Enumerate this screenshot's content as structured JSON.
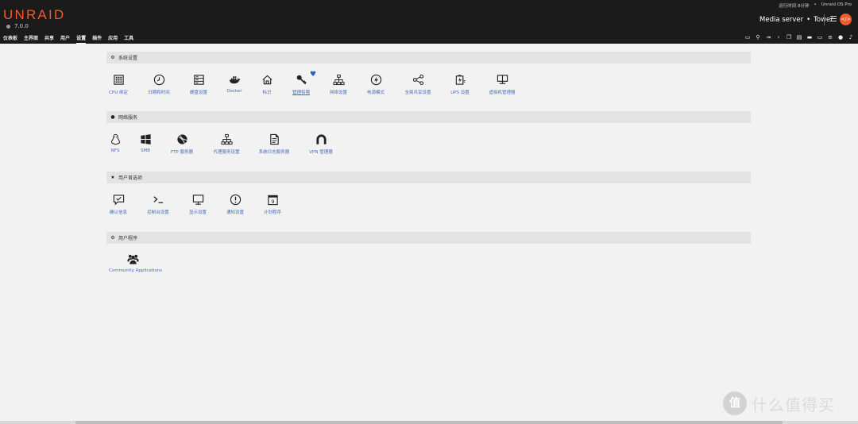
{
  "header": {
    "logo": "UNRAID",
    "version": "7.0.0",
    "uptime": "运行时间 8分钟",
    "edition": "Unraid OS Pro",
    "server_name": "Media server",
    "server_host": "Tower",
    "accent_color": "#f15a2c"
  },
  "nav": {
    "items": [
      {
        "label": "仪表板"
      },
      {
        "label": "主界面"
      },
      {
        "label": "共享"
      },
      {
        "label": "用户"
      },
      {
        "label": "设置"
      },
      {
        "label": "插件"
      },
      {
        "label": "应用"
      },
      {
        "label": "工具"
      }
    ],
    "active": "设置",
    "right_icons": [
      "feedback-icon",
      "search-icon",
      "logout-icon",
      "terminal-icon",
      "copy-icon",
      "log-icon",
      "display-icon",
      "monitor-icon",
      "notes-icon",
      "info-icon",
      "bell-icon"
    ]
  },
  "sections": [
    {
      "title": "系统设置",
      "icon": "gear-icon",
      "items": [
        {
          "label": "CPU 绑定",
          "icon": "cpu-icon"
        },
        {
          "label": "日期和时间",
          "icon": "clock-icon"
        },
        {
          "label": "硬盘设置",
          "icon": "disk-icon"
        },
        {
          "label": "Docker",
          "icon": "docker-icon"
        },
        {
          "label": "标识",
          "icon": "home-icon"
        },
        {
          "label": "管理权限",
          "icon": "key-icon"
        },
        {
          "label": "网络设置",
          "icon": "network-icon"
        },
        {
          "label": "电源模式",
          "icon": "power-icon"
        },
        {
          "label": "全局共享设置",
          "icon": "share-icon"
        },
        {
          "label": "UPS 设置",
          "icon": "battery-icon"
        },
        {
          "label": "虚拟机管理器",
          "icon": "vm-icon"
        }
      ]
    },
    {
      "title": "网络服务",
      "icon": "globe-icon",
      "items": [
        {
          "label": "NFS",
          "icon": "linux-icon"
        },
        {
          "label": "SMB",
          "icon": "windows-icon"
        },
        {
          "label": "FTP 服务器",
          "icon": "ftp-icon"
        },
        {
          "label": "代理服务设置",
          "icon": "proxy-icon"
        },
        {
          "label": "系统日志服务器",
          "icon": "syslog-icon"
        },
        {
          "label": "VPN 管理器",
          "icon": "vpn-icon"
        }
      ]
    },
    {
      "title": "用户首选项",
      "icon": "star-icon",
      "items": [
        {
          "label": "确认信息",
          "icon": "confirm-icon"
        },
        {
          "label": "控制台设置",
          "icon": "console-icon"
        },
        {
          "label": "显示设置",
          "icon": "display-icon"
        },
        {
          "label": "通知设置",
          "icon": "notify-icon"
        },
        {
          "label": "计划程序",
          "icon": "calendar-icon"
        }
      ]
    },
    {
      "title": "用户程序",
      "icon": "gears-icon",
      "items": [
        {
          "label": "Community Applications",
          "icon": "community-icon"
        }
      ]
    }
  ],
  "watermark": {
    "badge": "值",
    "text": "什么值得买"
  }
}
